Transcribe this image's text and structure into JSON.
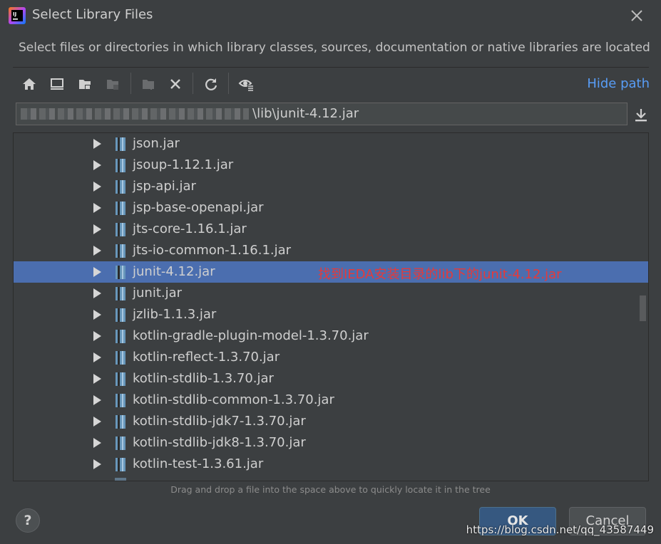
{
  "window": {
    "title": "Select Library Files",
    "description": "Select files or directories in which library classes, sources, documentation or native libraries are located"
  },
  "toolbar": {
    "buttons": [
      "home-icon",
      "desktop-icon",
      "project-folder-icon",
      "module-folder-icon",
      "new-folder-icon",
      "delete-icon",
      "refresh-icon",
      "show-hidden-icon"
    ],
    "hide_path_label": "Hide path"
  },
  "path": {
    "visible_suffix": "\\lib\\junit-4.12.jar"
  },
  "tree": {
    "items": [
      {
        "name": "json.jar"
      },
      {
        "name": "jsoup-1.12.1.jar"
      },
      {
        "name": "jsp-api.jar"
      },
      {
        "name": "jsp-base-openapi.jar"
      },
      {
        "name": "jts-core-1.16.1.jar"
      },
      {
        "name": "jts-io-common-1.16.1.jar"
      },
      {
        "name": "junit-4.12.jar",
        "selected": true
      },
      {
        "name": "junit.jar"
      },
      {
        "name": "jzlib-1.1.3.jar"
      },
      {
        "name": "kotlin-gradle-plugin-model-1.3.70.jar"
      },
      {
        "name": "kotlin-reflect-1.3.70.jar"
      },
      {
        "name": "kotlin-stdlib-1.3.70.jar"
      },
      {
        "name": "kotlin-stdlib-common-1.3.70.jar"
      },
      {
        "name": "kotlin-stdlib-jdk7-1.3.70.jar"
      },
      {
        "name": "kotlin-stdlib-jdk8-1.3.70.jar"
      },
      {
        "name": "kotlin-test-1.3.61.jar"
      }
    ],
    "annotation": "找到IEDA安装目录的lib下的junit-4.12.jar"
  },
  "hint": "Drag and drop a file into the space above to quickly locate it in the tree",
  "buttons": {
    "help": "?",
    "ok": "OK",
    "cancel": "Cancel"
  },
  "watermark": "https://blog.csdn.net/qq_43587449",
  "colors": {
    "background": "#3c3f41",
    "selection": "#4b6eaf",
    "link": "#589df6",
    "annotation": "#e53a3a",
    "ok_button": "#365880"
  }
}
